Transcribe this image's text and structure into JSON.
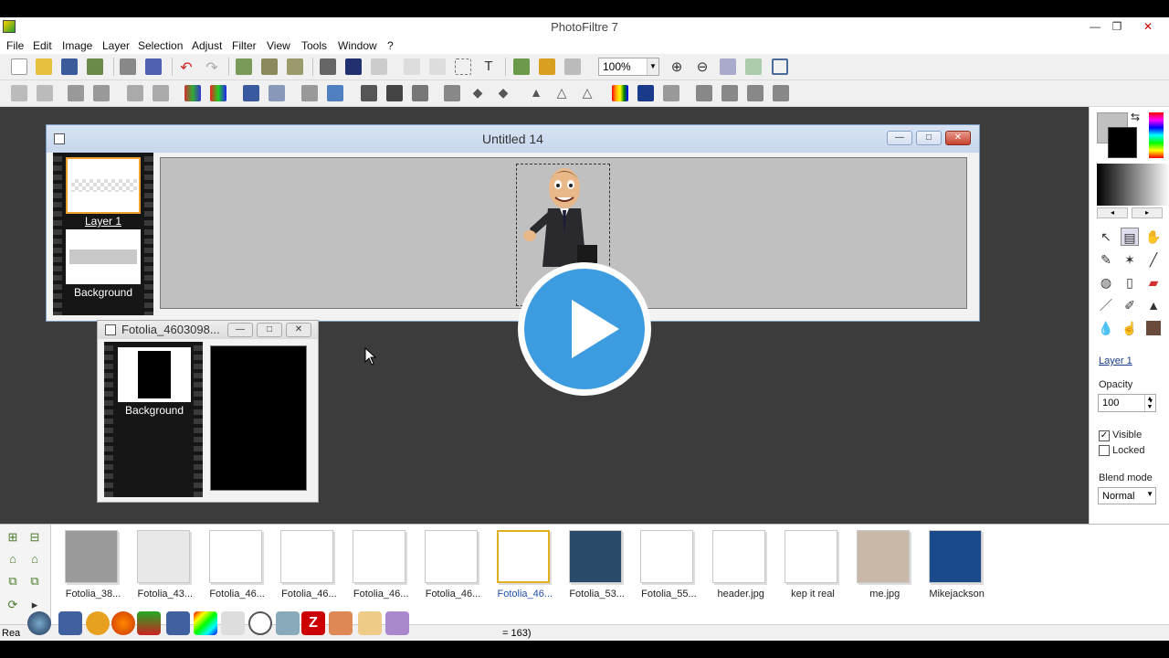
{
  "window": {
    "title": "PhotoFiltre 7"
  },
  "menu": [
    "File",
    "Edit",
    "Image",
    "Layer",
    "Selection",
    "Adjust",
    "Filter",
    "View",
    "Tools",
    "Window",
    "?"
  ],
  "toolbar": {
    "zoom": "100%"
  },
  "doc1": {
    "title": "Untitled 14",
    "layers": [
      {
        "label": "Layer 1"
      },
      {
        "label": "Background"
      }
    ]
  },
  "doc2": {
    "title": "Fotolia_4603098...",
    "layers": [
      {
        "label": "Background"
      }
    ]
  },
  "panel": {
    "layer_name": "Layer 1",
    "opacity_label": "Opacity",
    "opacity_value": "100",
    "visible_label": "Visible",
    "visible_checked": true,
    "locked_label": "Locked",
    "locked_checked": false,
    "blend_label": "Blend mode",
    "blend_value": "Normal"
  },
  "files": [
    {
      "name": "Fotolia_38..."
    },
    {
      "name": "Fotolia_43..."
    },
    {
      "name": "Fotolia_46..."
    },
    {
      "name": "Fotolia_46..."
    },
    {
      "name": "Fotolia_46..."
    },
    {
      "name": "Fotolia_46..."
    },
    {
      "name": "Fotolia_46...",
      "selected": true
    },
    {
      "name": "Fotolia_53..."
    },
    {
      "name": "Fotolia_55..."
    },
    {
      "name": "header.jpg"
    },
    {
      "name": "kep it real"
    },
    {
      "name": "me.jpg"
    },
    {
      "name": "Mikejackson"
    }
  ],
  "status": {
    "left": "Rea",
    "coords": "= 163)"
  },
  "colors": {
    "workspace": "#3c3c3c",
    "play": "#3d9be0",
    "accent": "#2050b0"
  }
}
